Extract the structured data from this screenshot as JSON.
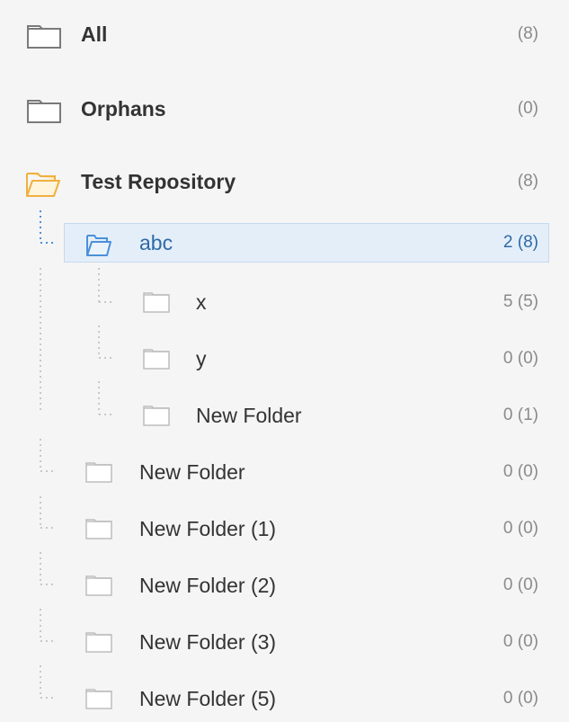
{
  "tree": {
    "all": {
      "label": "All",
      "count": "(8)",
      "icon": "folder-icon"
    },
    "orphans": {
      "label": "Orphans",
      "count": "(0)",
      "icon": "folder-icon"
    },
    "repository": {
      "label": "Test Repository",
      "count": "(8)",
      "icon": "folder-open-icon"
    },
    "abc": {
      "label": "abc",
      "count": "2 (8)",
      "icon": "folder-open-icon",
      "selected": true
    },
    "abc_children": [
      {
        "label": "x",
        "count": "5 (5)",
        "icon": "folder-icon"
      },
      {
        "label": "y",
        "count": "0 (0)",
        "icon": "folder-icon"
      },
      {
        "label": "New Folder",
        "count": "0 (1)",
        "icon": "folder-icon"
      }
    ],
    "repo_children": [
      {
        "label": "New Folder",
        "count": "0 (0)",
        "icon": "folder-icon"
      },
      {
        "label": "New Folder (1)",
        "count": "0 (0)",
        "icon": "folder-icon"
      },
      {
        "label": "New Folder (2)",
        "count": "0 (0)",
        "icon": "folder-icon"
      },
      {
        "label": "New Folder (3)",
        "count": "0 (0)",
        "icon": "folder-icon"
      },
      {
        "label": "New Folder (5)",
        "count": "0 (0)",
        "icon": "folder-icon"
      }
    ]
  },
  "colors": {
    "selected_text": "#2d6aa6",
    "selected_bg": "#e4eef9",
    "open_folder_orange": "#f0b040",
    "count_gray": "#8a8a8a"
  }
}
